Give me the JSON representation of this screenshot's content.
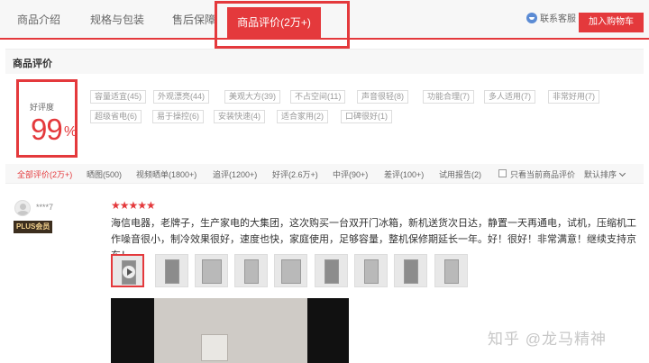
{
  "tabs": {
    "intro": "商品介绍",
    "spec": "规格与包装",
    "after_sale": "售后保障",
    "review": "商品评价(2万+)"
  },
  "header": {
    "service": "联系客服",
    "cart": "加入购物车"
  },
  "section": {
    "title": "商品评价"
  },
  "rating": {
    "label": "好评度",
    "value": "99",
    "unit": "%"
  },
  "tags": [
    "容量适宜(45)",
    "外观漂亮(44)",
    "美观大方(39)",
    "不占空间(11)",
    "声音很轻(8)",
    "功能合理(7)",
    "多人适用(7)",
    "非常好用(7)",
    "超级省电(6)",
    "易于操控(6)",
    "安装快速(4)",
    "适合家用(2)",
    "口碑很好(1)"
  ],
  "filters": [
    "全部评价(2万+)",
    "晒图(500)",
    "视频晒单(1800+)",
    "追评(1200+)",
    "好评(2.6万+)",
    "中评(90+)",
    "差评(100+)",
    "试用报告(2)"
  ],
  "only_current": "只看当前商品评价",
  "sort": "默认排序",
  "review": {
    "username": "****7",
    "badge": "PLUS会员",
    "stars": "★★★★★",
    "text": "海信电器，老牌子，生产家电的大集团，这次购买一台双开门冰箱，新机送货次日达，静置一天再通电，试机，压缩机工作噪音很小，制冷效果很好，速度也快，家庭使用，足够容量，整机保修期延长一年。好！很好！非常满意！继续支持京东！"
  },
  "watermark": "知乎 @龙马精神",
  "colors": {
    "accent": "#e4393c",
    "plus_bg": "#3c2e1e",
    "plus_text": "#f3d28e"
  }
}
